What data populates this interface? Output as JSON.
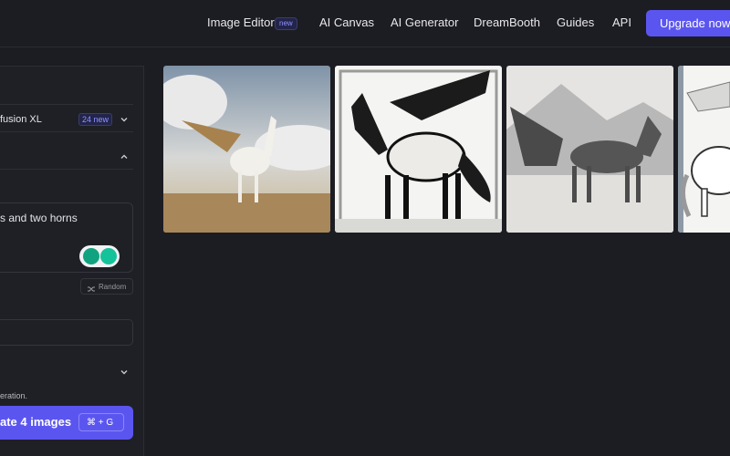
{
  "nav": {
    "image_editor": "Image Editor",
    "image_editor_badge": "new",
    "ai_canvas": "AI Canvas",
    "ai_generator": "AI Generator",
    "dreambooth": "DreamBooth",
    "guides": "Guides",
    "api": "API",
    "upgrade": "Upgrade now"
  },
  "panel": {
    "model_name": "fusion XL",
    "model_badge": "24 new",
    "prompt_text": "s and two horns",
    "random_label": "Random",
    "hint": "eration.",
    "generate_label": "ate 4 images",
    "shortcut": "⌘ + G"
  },
  "gallery": {
    "images": [
      {
        "subject": "winged white horse on desert plain"
      },
      {
        "subject": "black and white pegasus illustration in frame"
      },
      {
        "subject": "dark winged horse on snowy ground"
      },
      {
        "subject": "white pegasus sketch"
      }
    ]
  },
  "colors": {
    "accent": "#5b55f0",
    "background": "#1c1d22",
    "panel": "#1f2025",
    "badge_text": "#8f93ff"
  }
}
